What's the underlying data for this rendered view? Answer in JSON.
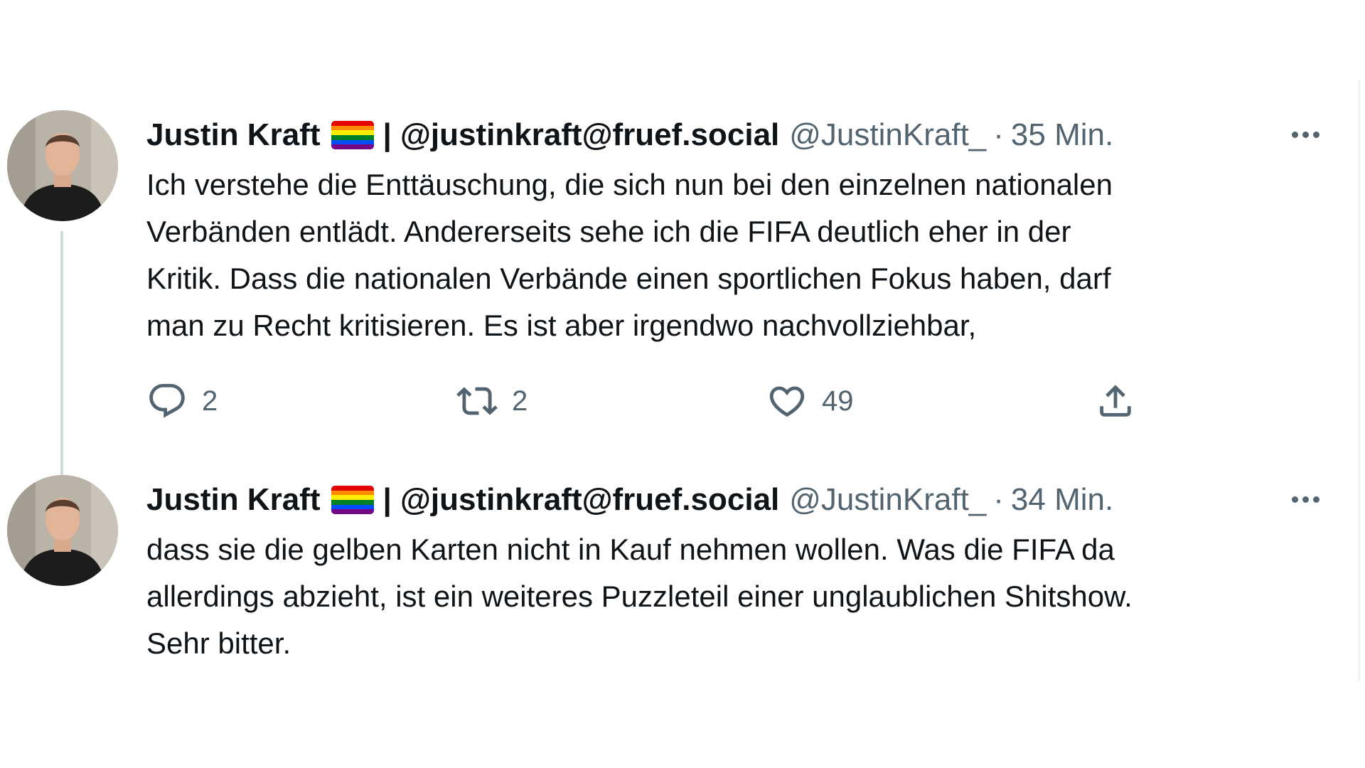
{
  "colors": {
    "text_primary": "#0f1419",
    "text_secondary": "#536471",
    "thread_line": "#cfd9de",
    "pride_flag": [
      "#e40303",
      "#ff8c00",
      "#ffed00",
      "#008026",
      "#004dff",
      "#750787"
    ]
  },
  "tweets": [
    {
      "author_name": "Justin Kraft",
      "author_extra": "| @justinkraft@fruef.social",
      "handle": "@JustinKraft_",
      "separator": "·",
      "time": "35 Min.",
      "text_lines": [
        "Ich verstehe die Enttäuschung, die sich nun bei den einzelnen nationalen",
        "Verbänden entlädt. Andererseits sehe ich die FIFA deutlich eher in der",
        "Kritik. Dass die nationalen Verbände einen sportlichen Fokus haben, darf",
        "man zu Recht kritisieren. Es ist aber irgendwo nachvollziehbar,"
      ],
      "actions": {
        "replies": "2",
        "retweets": "2",
        "likes": "49"
      }
    },
    {
      "author_name": "Justin Kraft",
      "author_extra": "| @justinkraft@fruef.social",
      "handle": "@JustinKraft_",
      "separator": "·",
      "time": "34 Min.",
      "text_lines": [
        "dass sie die gelben Karten nicht in Kauf nehmen wollen. Was die FIFA da",
        "allerdings abzieht, ist ein weiteres Puzzleteil einer unglaublichen Shitshow.",
        "Sehr bitter."
      ]
    }
  ],
  "icons": {
    "reply": "reply-icon",
    "retweet": "retweet-icon",
    "like": "heart-icon",
    "share": "share-icon",
    "more": "more-icon",
    "flag": "rainbow-flag-icon"
  }
}
